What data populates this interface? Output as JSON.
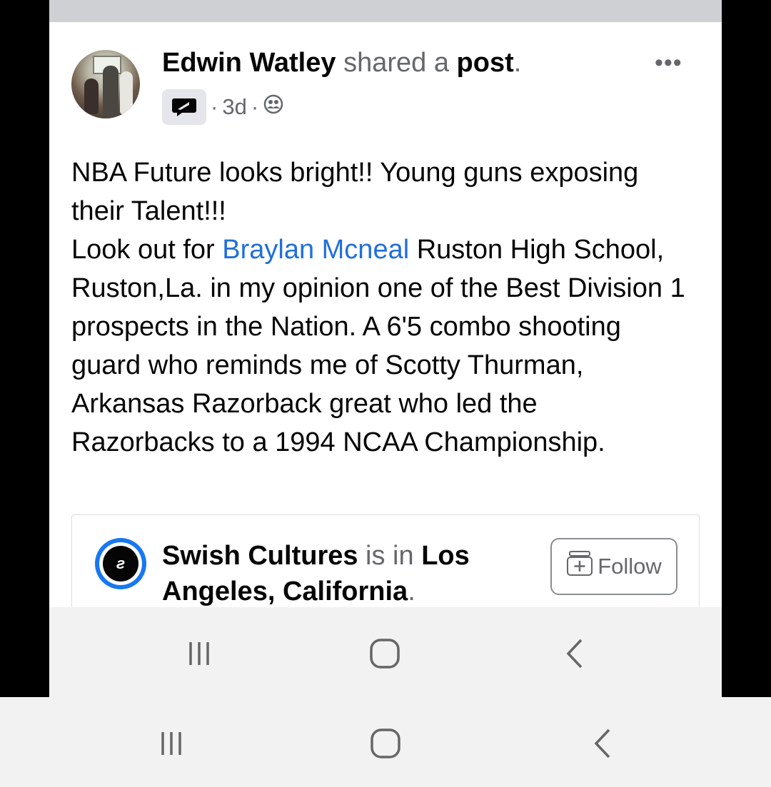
{
  "post": {
    "author": "Edwin Watley",
    "action_text": " shared a ",
    "object": "post",
    "period": ".",
    "time": "3d",
    "dot": "·",
    "more_label": "•••"
  },
  "body": {
    "line1": "NBA Future looks bright!!  Young guns exposing their Talent!!!",
    "look_out_prefix": "Look out for ",
    "tagged_name": "Braylan Mcneal",
    "rest": " Ruston High School, Ruston,La. in my opinion one of the Best Division 1 prospects in the Nation. A 6'5 combo shooting guard who reminds me of Scotty Thurman, Arkansas Razorback great who led the Razorbacks to a 1994 NCAA Championship."
  },
  "shared": {
    "page_name": "Swish Cultures",
    "is_in": " is in ",
    "location": "Los Angeles, California",
    "period": ".",
    "logo_glyph": "ƨ",
    "follow_label": "Follow"
  },
  "icons": {
    "share_chip": "shared-post-icon",
    "audience": "friends-audience-icon",
    "follow": "follow-plus-icon"
  },
  "colors": {
    "link": "#216fdb",
    "secondary_text": "#65676b",
    "primary_text": "#050505",
    "logo_ring": "#1877f2"
  }
}
